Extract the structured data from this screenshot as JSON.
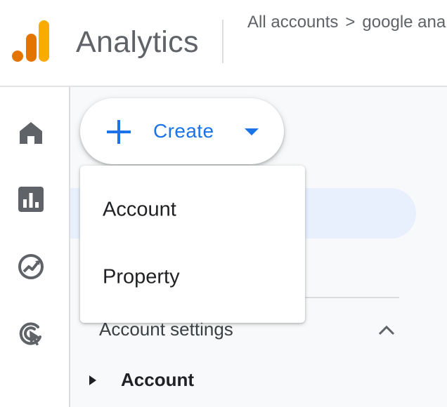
{
  "header": {
    "app_title": "Analytics",
    "logo_icon": "analytics-logo-icon",
    "breadcrumb": {
      "root": "All accounts",
      "separator": ">",
      "current": "google ana"
    }
  },
  "rail": {
    "icons": [
      "home-icon",
      "reports-icon",
      "explore-icon",
      "advertising-icon"
    ]
  },
  "create_button": {
    "label": "Create",
    "icon": "plus-icon",
    "accent": "#1a73e8"
  },
  "create_menu": {
    "items": [
      "Account",
      "Property"
    ]
  },
  "settings": {
    "heading": "Account settings",
    "rows": [
      {
        "label": "Account"
      }
    ]
  },
  "colors": {
    "accent": "#1a73e8",
    "logo_dark": "#e37400",
    "logo_light": "#f9ab00",
    "nav_highlight": "#e8f0fe",
    "icon_grey": "#5f6368"
  }
}
